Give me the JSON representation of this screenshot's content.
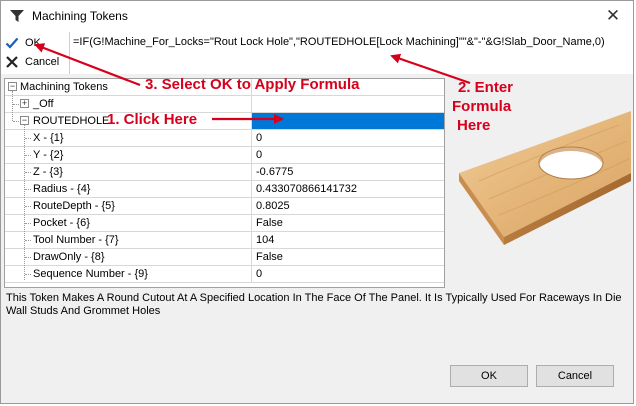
{
  "window": {
    "title": "Machining Tokens",
    "close_glyph": "✕"
  },
  "toolbar": {
    "ok_label": "OK",
    "cancel_label": "Cancel"
  },
  "formula": {
    "value": "=IF(G!Machine_For_Locks=\"Rout Lock Hole\",\"ROUTEDHOLE[Lock Machining]\"\"&\"-\"&G!Slab_Door_Name,0)"
  },
  "grid": {
    "root": "Machining Tokens",
    "items": [
      {
        "name": "_Off",
        "value": ""
      },
      {
        "name": "ROUTEDHOLE",
        "value": ""
      }
    ],
    "children": [
      {
        "name": "X - {1}",
        "value": "0"
      },
      {
        "name": "Y - {2}",
        "value": "0"
      },
      {
        "name": "Z - {3}",
        "value": "-0.6775"
      },
      {
        "name": "Radius - {4}",
        "value": "0.433070866141732"
      },
      {
        "name": "RouteDepth - {5}",
        "value": "0.8025"
      },
      {
        "name": "Pocket - {6}",
        "value": "False"
      },
      {
        "name": "Tool Number - {7}",
        "value": "104"
      },
      {
        "name": "DrawOnly - {8}",
        "value": "False"
      },
      {
        "name": "Sequence Number - {9}",
        "value": "0"
      }
    ]
  },
  "description": "This Token Makes A Round Cutout At A Specified Location In The Face Of The Panel. It Is Typically Used For Raceways In Die Wall Studs And Grommet Holes",
  "buttons": {
    "ok": "OK",
    "cancel": "Cancel"
  },
  "annotations": {
    "step1": "1. Click Here",
    "step2_line1": "2. Enter",
    "step2_line2": "Formula",
    "step2_line3": "Here",
    "step3": "3. Select OK to Apply Formula"
  },
  "colors": {
    "annotation": "#d6001c",
    "selection": "#0078d7",
    "ok_check": "#1e5fb4",
    "cancel_x": "#222222"
  },
  "icons": {
    "title": "funnel-icon",
    "ok": "checkmark-icon",
    "cancel": "x-icon"
  }
}
